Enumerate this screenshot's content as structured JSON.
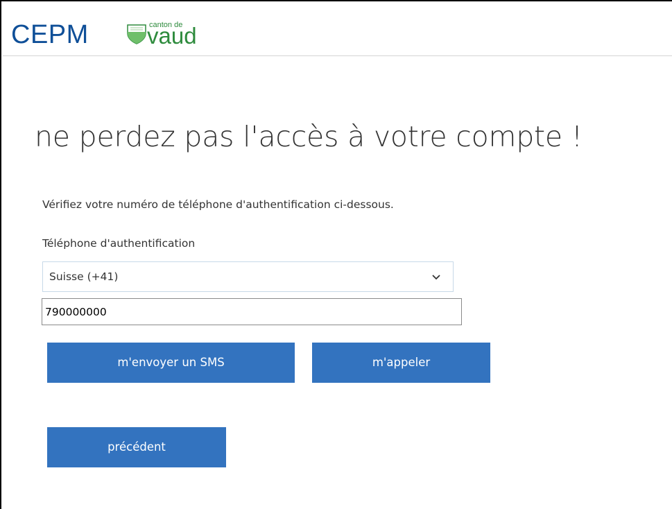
{
  "header": {
    "logo_text": "CEPM",
    "vaud_small_text": "canton de",
    "vaud_big_text": "vaud"
  },
  "main": {
    "title": "ne perdez pas l'accès à votre compte !",
    "intro": "Vérifiez votre numéro de téléphone d'authentification ci-dessous.",
    "phone_label": "Téléphone d'authentification",
    "country_select": {
      "value": "Suisse (+41)",
      "icon": "chevron-down-icon"
    },
    "phone_input": {
      "value": "790000000"
    },
    "buttons": {
      "sms": "m'envoyer un SMS",
      "call": "m'appeler",
      "previous": "précédent"
    }
  },
  "colors": {
    "brand_blue": "#0f4f98",
    "button_blue": "#3373bf",
    "vaud_green": "#2e8b3d"
  }
}
